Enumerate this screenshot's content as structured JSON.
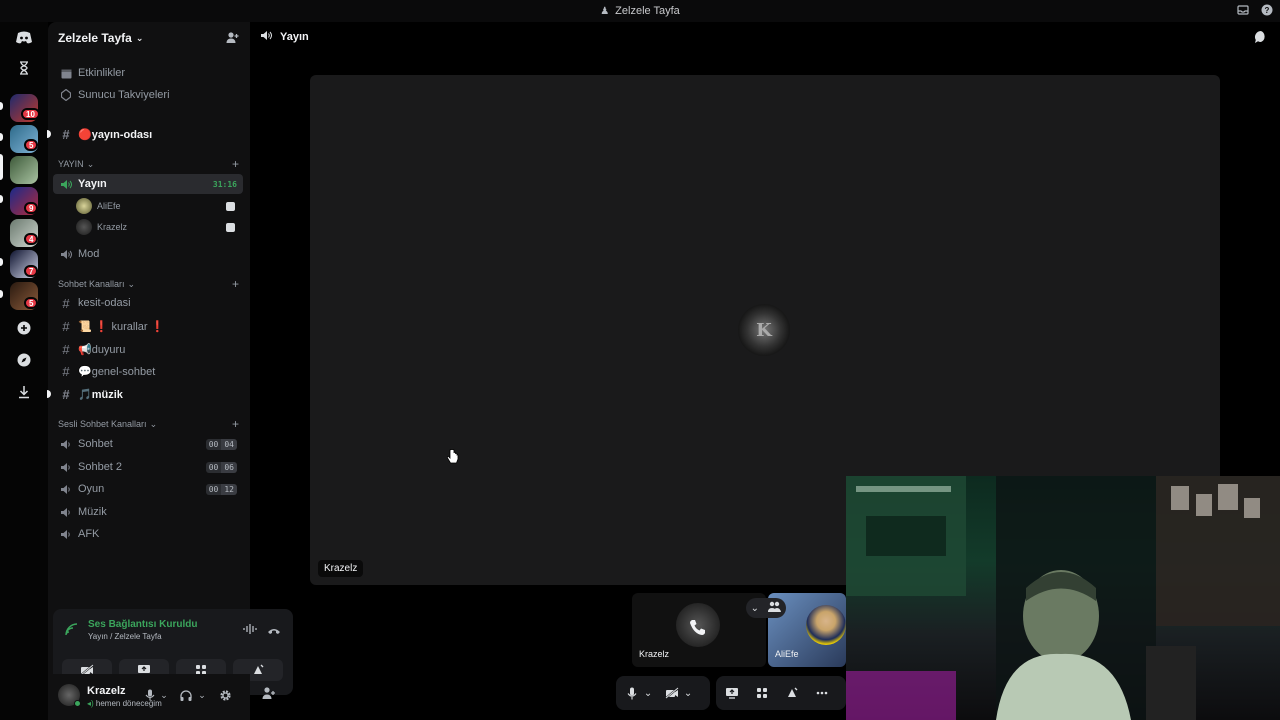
{
  "window": {
    "title": "Zelzele Tayfa"
  },
  "rail": {
    "badges": [
      "10",
      "5",
      "9",
      "4",
      "7",
      "5"
    ]
  },
  "guild": {
    "name": "Zelzele Tayfa"
  },
  "sidebar": {
    "top_items": [
      {
        "label": "Etkinlikler",
        "icon": "calendar-icon"
      },
      {
        "label": "Sunucu Takviyeleri",
        "icon": "boost-icon"
      }
    ],
    "pinned_channel": {
      "label": "🔴yayın-odası",
      "icon": "hash-icon"
    },
    "cat_yayin": "YAYIN",
    "voice_active": {
      "label": "Yayın",
      "timer": "31:16"
    },
    "voice_users": [
      "AliEfe",
      "Krazelz"
    ],
    "mod_channel": "Mod",
    "cat_sohbet": "Sohbet Kanalları",
    "text_channels": [
      {
        "label": "kesit-odasi"
      },
      {
        "label": "📜 ❗ kurallar ❗"
      },
      {
        "label": "📢duyuru"
      },
      {
        "label": "💬genel-sohbet"
      },
      {
        "label": "🎵müzik"
      }
    ],
    "cat_sesli": "Sesli Sohbet Kanalları",
    "voice_channels": [
      {
        "label": "Sohbet",
        "a": "00",
        "b": "04"
      },
      {
        "label": "Sohbet 2",
        "a": "00",
        "b": "06"
      },
      {
        "label": "Oyun",
        "a": "00",
        "b": "12"
      },
      {
        "label": "Müzik"
      },
      {
        "label": "AFK"
      }
    ]
  },
  "voice_panel": {
    "status": "Ses Bağlantısı Kuruldu",
    "location": "Yayın / Zelzele Tayfa"
  },
  "user": {
    "name": "Krazelz",
    "status": "hemen döneceğim"
  },
  "main": {
    "channel": "Yayın",
    "stage_label": "Krazelz",
    "stage_avatar_text": "K",
    "tiles": [
      "Krazelz",
      "AliEfe"
    ]
  },
  "colors": {
    "accent_green": "#3ba55c",
    "badge_red": "#e63946",
    "background": "#000000",
    "sidebar": "#101011"
  }
}
